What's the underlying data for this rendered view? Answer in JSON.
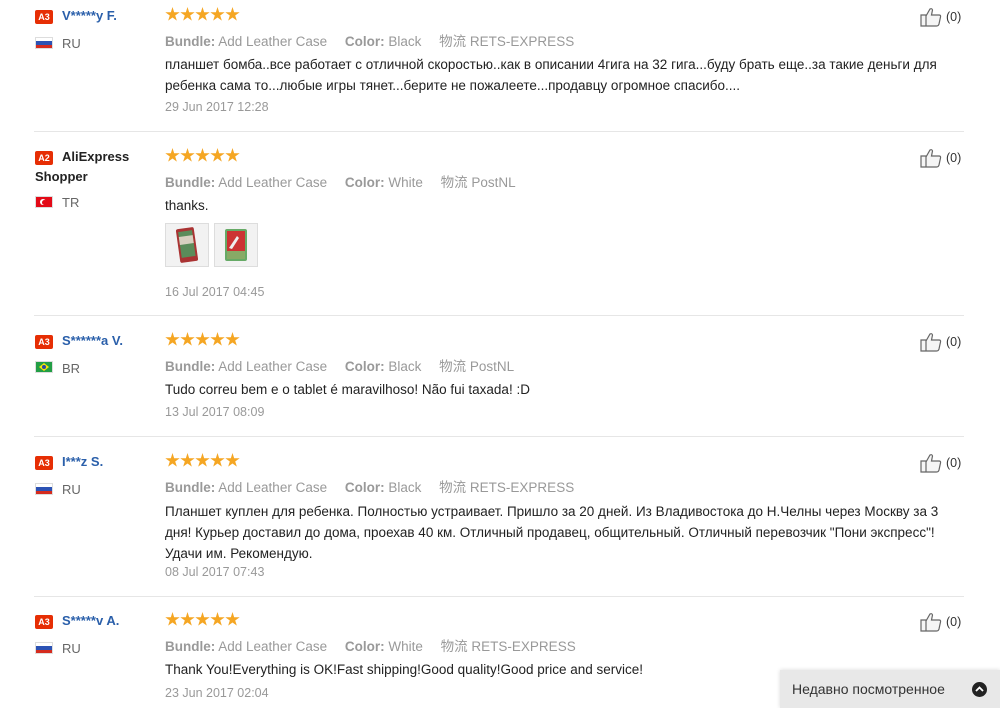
{
  "reviews": [
    {
      "badge": "A3",
      "name": "V*****y F.",
      "country": "RU",
      "flag": "ru",
      "bundle_label": "Bundle:",
      "bundle_value": "Add Leather Case",
      "color_label": "Color:",
      "color_value": "Black",
      "shipping_label": "物流",
      "shipping_value": "RETS-EXPRESS",
      "text": "планшет бомба..все работает с отличной скоростью..как в описании 4гига на 32 гига...буду брать еще..за такие деньги для ребенка сама то...любые игры тянет...берите не пожалеете...продавцу огромное спасибо....",
      "date": "29 Jun 2017 12:28",
      "likes": "(0)",
      "rating": 5
    },
    {
      "badge": "A2",
      "name": "AliExpress",
      "name_line2": "Shopper",
      "country": "TR",
      "flag": "tr",
      "bundle_label": "Bundle:",
      "bundle_value": "Add Leather Case",
      "color_label": "Color:",
      "color_value": "White",
      "shipping_label": "物流",
      "shipping_value": "PostNL",
      "text": "thanks.",
      "date": "16 Jul 2017 04:45",
      "likes": "(0)",
      "rating": 5,
      "photos": 2
    },
    {
      "badge": "A3",
      "name": "S******a V.",
      "country": "BR",
      "flag": "br",
      "bundle_label": "Bundle:",
      "bundle_value": "Add Leather Case",
      "color_label": "Color:",
      "color_value": "Black",
      "shipping_label": "物流",
      "shipping_value": "PostNL",
      "text": "Tudo correu bem e o tablet é maravilhoso! Não fui taxada! :D",
      "date": "13 Jul 2017 08:09",
      "likes": "(0)",
      "rating": 5
    },
    {
      "badge": "A3",
      "name": "I***z S.",
      "country": "RU",
      "flag": "ru",
      "bundle_label": "Bundle:",
      "bundle_value": "Add Leather Case",
      "color_label": "Color:",
      "color_value": "Black",
      "shipping_label": "物流",
      "shipping_value": "RETS-EXPRESS",
      "text": "Планшет куплен для ребенка. Полностью устраивает. Пришло за 20 дней. Из Владивостока до Н.Челны через Москву за 3 дня! Курьер доставил до дома, проехав 40 км. Отличный продавец, общительный. Отличный перевозчик \"Пони экспресс\"! Удачи им. Рекомендую.",
      "date": "08 Jul 2017 07:43",
      "likes": "(0)",
      "rating": 5
    },
    {
      "badge": "A3",
      "name": "S*****v A.",
      "country": "RU",
      "flag": "ru",
      "bundle_label": "Bundle:",
      "bundle_value": "Add Leather Case",
      "color_label": "Color:",
      "color_value": "White",
      "shipping_label": "物流",
      "shipping_value": "RETS-EXPRESS",
      "text": "Thank You!Everything is OK!Fast shipping!Good quality!Good price and service!",
      "date": "23 Jun 2017 02:04",
      "likes": "(0)",
      "rating": 5
    }
  ],
  "recently_viewed": {
    "label": "Недавно посмотренное",
    "icon": "chevron-up-icon"
  },
  "colors": {
    "star": "#f5a623",
    "badge": "#e62e04",
    "name_link": "#2a5faa"
  }
}
